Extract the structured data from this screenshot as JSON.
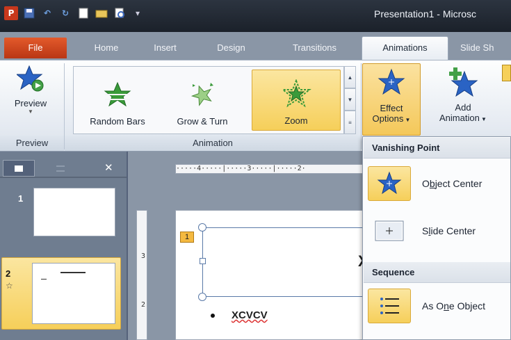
{
  "window": {
    "title": "Presentation1 - Microsc"
  },
  "tabs": {
    "file": "File",
    "home": "Home",
    "insert": "Insert",
    "design": "Design",
    "transitions": "Transitions",
    "animations": "Animations",
    "slideshow": "Slide Sh"
  },
  "ribbon": {
    "preview": {
      "label": "Preview",
      "group": "Preview"
    },
    "animation_group": "Animation",
    "gallery": [
      {
        "label": "Random Bars",
        "icon": "random-bars-icon"
      },
      {
        "label": "Grow & Turn",
        "icon": "grow-turn-icon"
      },
      {
        "label": "Zoom",
        "icon": "zoom-icon",
        "selected": true
      }
    ],
    "effect_options": {
      "line1": "Effect",
      "line2": "Options"
    },
    "add_animation": {
      "line1": "Add",
      "line2": "Animation"
    }
  },
  "left_pane": {
    "slides": [
      {
        "number": "1"
      },
      {
        "number": "2",
        "selected": true
      }
    ]
  },
  "ruler": {
    "text": "·····4·····|·····3·····|·····2·"
  },
  "slide": {
    "tag": "1",
    "bullet_text": "XCVCV",
    "partial_text": "X"
  },
  "dropdown": {
    "vanishing_header": "Vanishing Point",
    "object_center": {
      "pre": "O",
      "key": "b",
      "post": "ject Center",
      "selected": true
    },
    "slide_center": {
      "pre": "S",
      "key": "l",
      "post": "ide Center"
    },
    "sequence_header": "Sequence",
    "as_one_object": {
      "pre": "As O",
      "key": "n",
      "post": "e Object",
      "selected": true
    }
  },
  "colors": {
    "accent": "#f6d05a",
    "file_tab": "#d24a1f",
    "star": "#2a63c4",
    "green_star": "#3a9a3a"
  }
}
